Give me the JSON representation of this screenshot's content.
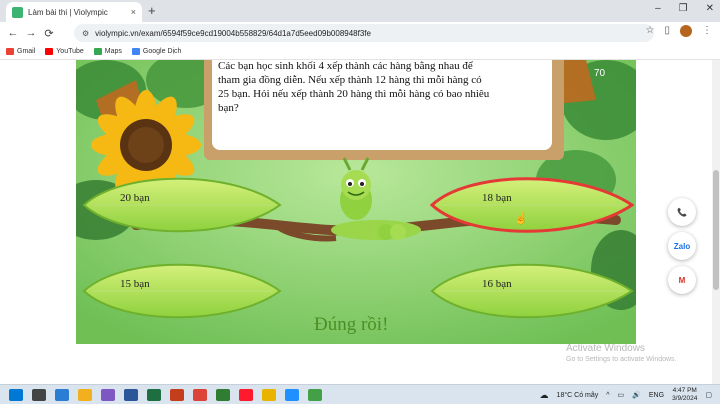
{
  "browser": {
    "tab_title": "Làm bài thi | Violympic",
    "tab_close": "×",
    "new_tab": "+",
    "url": "violympic.vn/exam/6594f59ce9cd19004b558829/64d1a7d5eed09b008948f3fe",
    "window_controls": [
      "–",
      "❐",
      "✕"
    ],
    "nav": [
      "←",
      "→",
      "⟳"
    ],
    "bookmarks": [
      {
        "label": "Gmail",
        "color": "#ea4335"
      },
      {
        "label": "YouTube",
        "color": "#ff0000"
      },
      {
        "label": "Maps",
        "color": "#34a853"
      },
      {
        "label": "Google Dịch",
        "color": "#4285f4"
      }
    ]
  },
  "question": {
    "text_lines": [
      "Các bạn học sinh khối 4 xếp thành các hàng bằng nhau để",
      "tham gia đồng diễn. Nếu xếp thành 12 hàng thì mỗi hàng có",
      "25 bạn. Hỏi nếu xếp thành 20 hàng thì mỗi hàng có bao nhiêu",
      "bạn?"
    ],
    "score": "70"
  },
  "answers": [
    {
      "label": "20 bạn",
      "selected": false
    },
    {
      "label": "18 bạn",
      "selected": true
    },
    {
      "label": "15 bạn",
      "selected": false
    },
    {
      "label": "16 bạn",
      "selected": false
    }
  ],
  "feedback": "Đúng rồi!",
  "side_buttons": [
    {
      "label": "📞",
      "color": "#1a73e8"
    },
    {
      "label": "Zalo",
      "color": "#1a73e8"
    },
    {
      "label": "M",
      "color": "#d93025"
    }
  ],
  "watermark": {
    "line1": "Activate Windows",
    "line2": "Go to Settings to activate Windows."
  },
  "taskbar": {
    "weather": "18°C  Có mây",
    "language": "ENG",
    "time": "4:47 PM",
    "date": "3/9/2024",
    "apps": [
      "#0078d4",
      "#444",
      "#f2b01e",
      "#2b7cd3",
      "#1d6f42",
      "#c43e1c",
      "#7e57c2",
      "#db4437",
      "#ff1b2d",
      "#0067b8",
      "#e8b400",
      "#1e90ff",
      "#2e7d32"
    ]
  },
  "colors": {
    "leaf_light": "#c8ec6a",
    "leaf_dark": "#7cc23a",
    "selected_outline": "#e53935",
    "feedback": "#4e8f25",
    "branch": "#7a4a2a"
  }
}
